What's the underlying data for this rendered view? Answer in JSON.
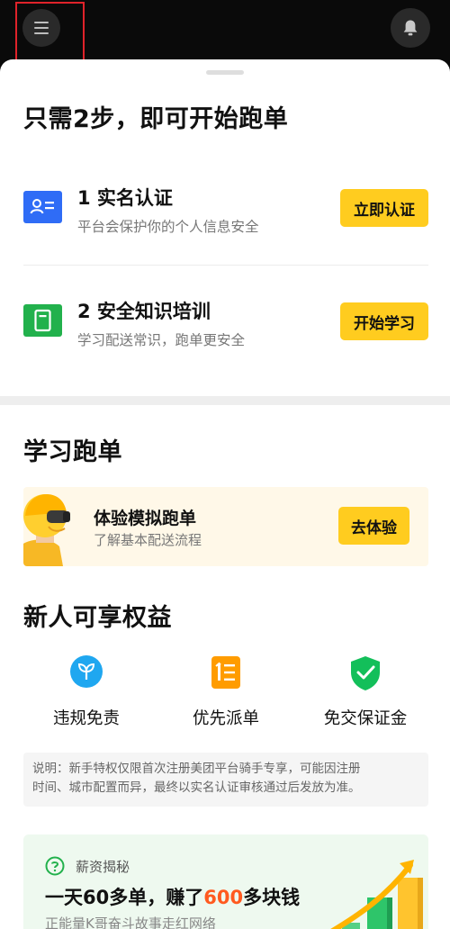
{
  "header": {
    "menu_icon": "menu-icon",
    "bell_icon": "bell-icon"
  },
  "steps_section": {
    "title": "只需2步，即可开始跑单",
    "steps": [
      {
        "title": "1 实名认证",
        "subtitle": "平台会保护你的个人信息安全",
        "button": "立即认证",
        "icon": "id-card-icon",
        "color": "#2f6cf6"
      },
      {
        "title": "2 安全知识培训",
        "subtitle": "学习配送常识，跑单更安全",
        "button": "开始学习",
        "icon": "book-icon",
        "color": "#22b14c"
      }
    ]
  },
  "learn_section": {
    "title": "学习跑单",
    "card": {
      "title": "体验模拟跑单",
      "subtitle": "了解基本配送流程",
      "button": "去体验"
    }
  },
  "benefits_section": {
    "title": "新人可享权益",
    "items": [
      {
        "label": "违规免责",
        "icon": "sprout-icon"
      },
      {
        "label": "优先派单",
        "icon": "priority-list-icon"
      },
      {
        "label": "免交保证金",
        "icon": "shield-check-icon"
      }
    ],
    "note_lines": [
      "说明：新手特权仅限首次注册美团平台骑手专享，可能因注册",
      "时间、城市配置而异，最终以实名认证审核通过后发放为准。"
    ]
  },
  "promo": {
    "tag": "薪资揭秘",
    "title_pre": "一天60多单，赚了",
    "title_highlight": "600",
    "title_post": "多块钱",
    "subtitle": "正能量K哥奋斗故事走红网络"
  },
  "colors": {
    "accent_yellow": "#ffcc1f",
    "primary_blue": "#2f6cf6",
    "success_green": "#22b14c",
    "highlight_orange": "#ff5a1f"
  }
}
